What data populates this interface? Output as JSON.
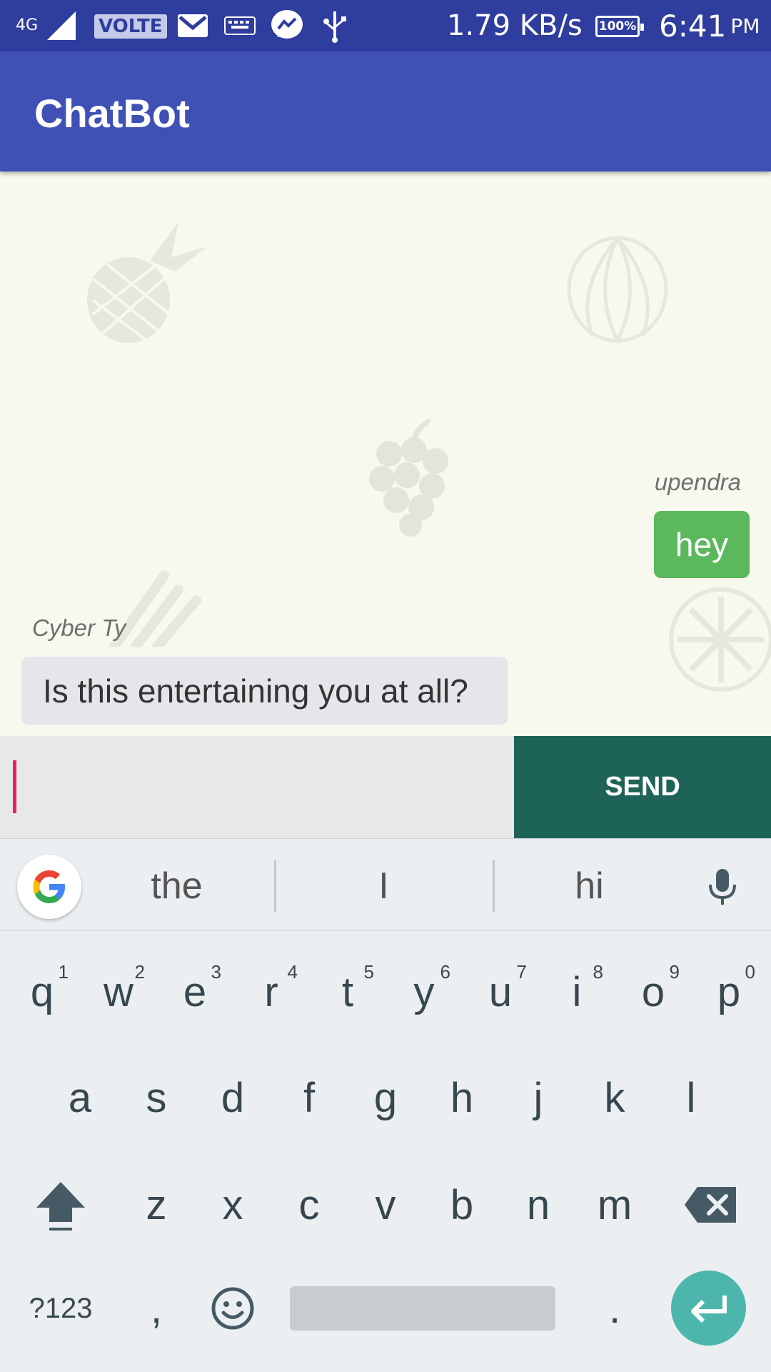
{
  "status_bar": {
    "network": "4G",
    "volte": "VOLTE",
    "speed": "1.79 KB/s",
    "battery": "100%",
    "time": "6:41",
    "ampm": "PM"
  },
  "app_bar": {
    "title": "ChatBot"
  },
  "chat": {
    "messages": [
      {
        "sender": "upendra",
        "text": "hey",
        "side": "right"
      },
      {
        "sender": "Cyber Ty",
        "text": "Is this entertaining you at all?",
        "side": "left"
      }
    ]
  },
  "composer": {
    "input_value": "",
    "send_label": "SEND"
  },
  "suggestions": [
    "the",
    "I",
    "hi"
  ],
  "keyboard": {
    "row1": [
      {
        "key": "q",
        "hint": "1"
      },
      {
        "key": "w",
        "hint": "2"
      },
      {
        "key": "e",
        "hint": "3"
      },
      {
        "key": "r",
        "hint": "4"
      },
      {
        "key": "t",
        "hint": "5"
      },
      {
        "key": "y",
        "hint": "6"
      },
      {
        "key": "u",
        "hint": "7"
      },
      {
        "key": "i",
        "hint": "8"
      },
      {
        "key": "o",
        "hint": "9"
      },
      {
        "key": "p",
        "hint": "0"
      }
    ],
    "row2": [
      "a",
      "s",
      "d",
      "f",
      "g",
      "h",
      "j",
      "k",
      "l"
    ],
    "row3": [
      "z",
      "x",
      "c",
      "v",
      "b",
      "n",
      "m"
    ],
    "symbols_label": "?123",
    "comma": ",",
    "period": "."
  },
  "colors": {
    "status_bar": "#2f3d9e",
    "app_bar": "#3f51b5",
    "chat_bg": "#f8f9ee",
    "my_bubble": "#5cb85c",
    "bot_bubble": "#e4e6ea",
    "send_button": "#1e6357",
    "enter_key": "#4db6ac",
    "cursor": "#e91e63"
  },
  "icons": [
    "signal-icon",
    "gmail-icon",
    "keyboard-icon",
    "messenger-icon",
    "usb-icon",
    "battery-icon",
    "google-icon",
    "mic-icon",
    "shift-icon",
    "backspace-icon",
    "emoji-icon",
    "enter-icon"
  ]
}
